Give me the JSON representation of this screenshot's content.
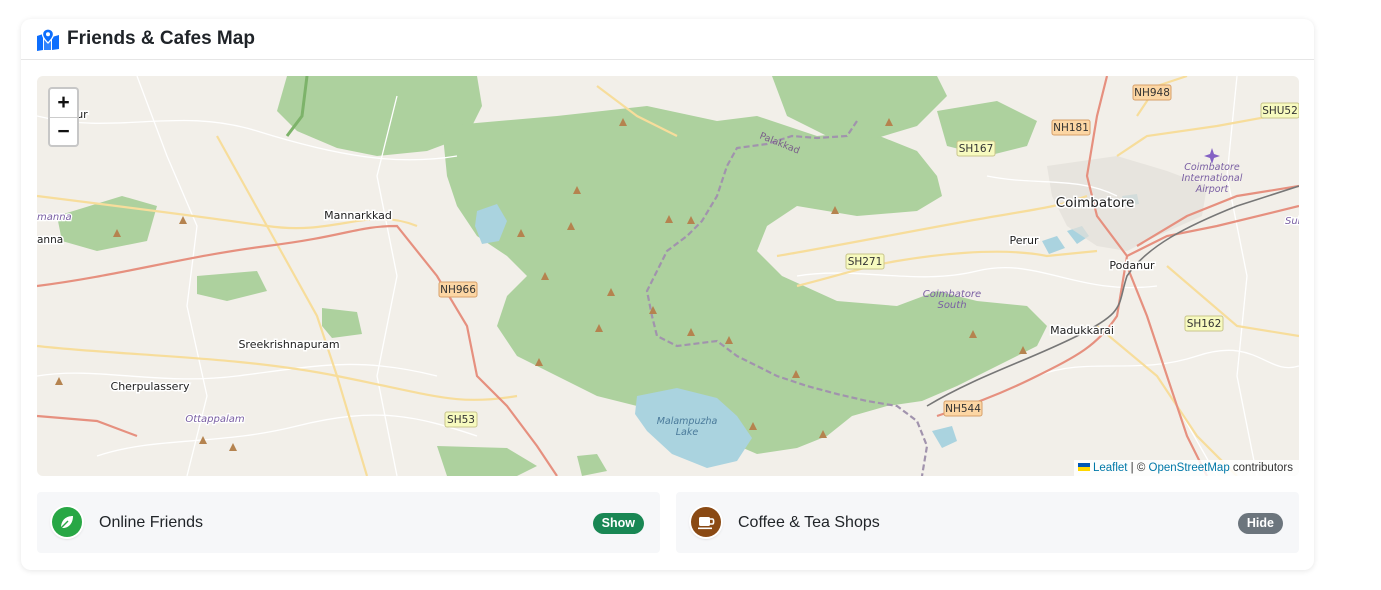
{
  "app": {
    "title": "Friends & Cafes Map",
    "title_icon": "map-marked-icon"
  },
  "map": {
    "zoom_controls": {
      "zoom_in": "+",
      "zoom_out": "−"
    },
    "attribution": {
      "leaflet": "Leaflet",
      "separator": " | © ",
      "osm": "OpenStreetMap",
      "suffix": " contributors"
    },
    "places": {
      "coimbatore": "Coimbatore",
      "mannarkkad": "Mannarkkad",
      "sreekrishnapuram": "Sreekrishnapuram",
      "cherpulassery": "Cherpulassery",
      "ottappalam": "Ottappalam",
      "perur": "Perur",
      "podanur": "Podanur",
      "madukkarai": "Madukkarai",
      "coimbatore_south": "Coimbatore South",
      "malampuzha_lake": "Malampuzha Lake",
      "palakkad": "Palakkad",
      "airport": "Coimbatore International Airport",
      "pelattur": "elattur",
      "anna": "anna",
      "manna": "manna",
      "sul": "Sul"
    },
    "road_shields": [
      "NH948",
      "SHU52",
      "NH181",
      "SH167",
      "SH271",
      "NH966",
      "SH162",
      "NH544",
      "SH53"
    ]
  },
  "layers": [
    {
      "label": "Online Friends",
      "icon": "leaf-icon",
      "toggle_label": "Show",
      "toggle_color": "#198754"
    },
    {
      "label": "Coffee & Tea Shops",
      "icon": "coffee-cup-icon",
      "toggle_label": "Hide",
      "toggle_color": "#6c757d"
    }
  ],
  "colors": {
    "accent_blue": "#0d6efd",
    "friends_green": "#28a745",
    "coffee_brown": "#8a4a14",
    "forest": "#add19e",
    "water": "#aad3df"
  }
}
